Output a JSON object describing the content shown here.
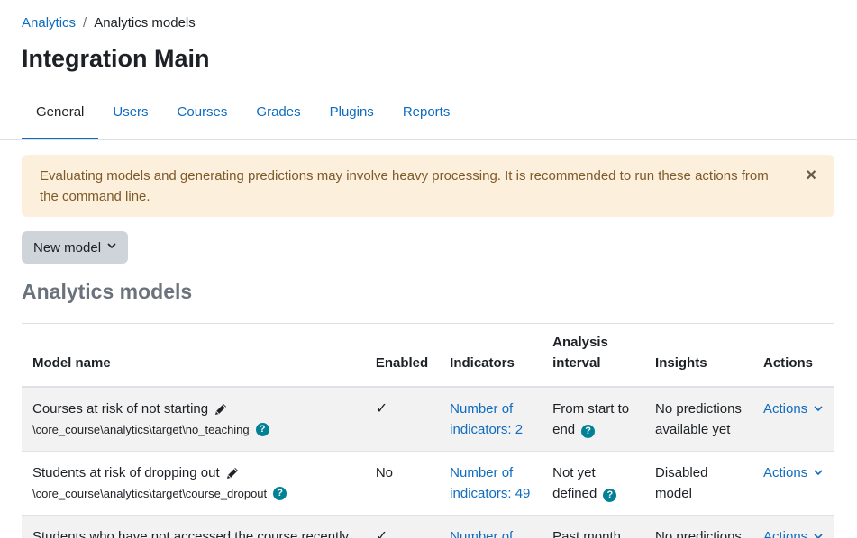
{
  "breadcrumb": {
    "parent": "Analytics",
    "separator": "/",
    "current": "Analytics models"
  },
  "page_title": "Integration Main",
  "tabs": [
    {
      "label": "General",
      "active": true
    },
    {
      "label": "Users",
      "active": false
    },
    {
      "label": "Courses",
      "active": false
    },
    {
      "label": "Grades",
      "active": false
    },
    {
      "label": "Plugins",
      "active": false
    },
    {
      "label": "Reports",
      "active": false
    }
  ],
  "alert": {
    "text": "Evaluating models and generating predictions may involve heavy processing. It is recommended to run these actions from the command line.",
    "close_symbol": "×"
  },
  "new_model_button": {
    "label": "New model"
  },
  "section_title": "Analytics models",
  "table": {
    "headers": {
      "model_name": "Model name",
      "enabled": "Enabled",
      "indicators": "Indicators",
      "analysis_interval_line1": "Analysis",
      "analysis_interval_line2": "interval",
      "insights": "Insights",
      "actions": "Actions"
    },
    "rows": [
      {
        "name": "Courses at risk of not starting",
        "target": "\\core_course\\analytics\\target\\no_teaching",
        "enabled": "✓",
        "indicators_line1": "Number of",
        "indicators_line2": "indicators: 2",
        "interval_line1": "From start to",
        "interval_line2": "end",
        "insights_line1": "No predictions",
        "insights_line2": "available yet",
        "actions": "Actions"
      },
      {
        "name": "Students at risk of dropping out",
        "target": "\\core_course\\analytics\\target\\course_dropout",
        "enabled": "No",
        "indicators_line1": "Number of",
        "indicators_line2": "indicators: 49",
        "interval_line1": "Not yet",
        "interval_line2": "defined",
        "insights_line1": "Disabled",
        "insights_line2": "model",
        "actions": "Actions"
      },
      {
        "name": "Students who have not accessed the course recently",
        "target": "",
        "enabled": "✓",
        "indicators_line1": "Number of",
        "indicators_line2": "",
        "interval_line1": "Past month",
        "interval_line2": "",
        "insights_line1": "No predictions",
        "insights_line2": "",
        "actions": "Actions"
      }
    ]
  },
  "colors": {
    "link": "#0f6cbf",
    "alert_bg": "#fcefdc",
    "alert_text": "#7d5a29",
    "help_icon": "#008196",
    "button_bg": "#ced4da"
  }
}
